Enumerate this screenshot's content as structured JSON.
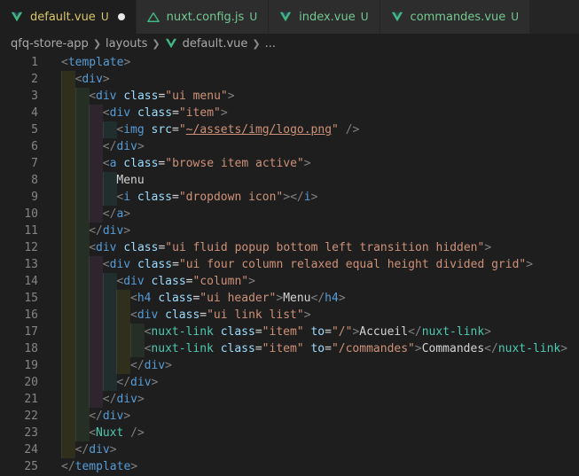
{
  "tabs": [
    {
      "label": "default.vue",
      "status": "U",
      "icon": "vue-icon",
      "active": true,
      "dirty": true,
      "untracked": true
    },
    {
      "label": "nuxt.config.js",
      "status": "U",
      "icon": "nuxt-icon",
      "active": false,
      "dirty": false,
      "untracked": true
    },
    {
      "label": "index.vue",
      "status": "U",
      "icon": "vue-icon",
      "active": false,
      "dirty": false,
      "untracked": true
    },
    {
      "label": "commandes.vue",
      "status": "U",
      "icon": "vue-icon",
      "active": false,
      "dirty": false,
      "untracked": true
    }
  ],
  "breadcrumb": {
    "root": "qfq-store-app",
    "folder": "layouts",
    "file": "default.vue",
    "more": "..."
  },
  "colors": {
    "tag": "#569cd6",
    "component": "#4ec9b0",
    "attribute": "#9cdcfe",
    "string": "#ce9178",
    "punctuation": "#808080",
    "text": "#d4d4d4",
    "vue_green": "#41b883",
    "modified_yellow": "#d9c56a",
    "untracked_green": "#73c991"
  },
  "editor": {
    "lines": [
      {
        "n": "1",
        "indent": 0,
        "tokens": [
          [
            "p",
            "<"
          ],
          [
            "tag",
            "template"
          ],
          [
            "p",
            ">"
          ]
        ]
      },
      {
        "n": "2",
        "indent": 1,
        "tokens": [
          [
            "p",
            "<"
          ],
          [
            "tag",
            "div"
          ],
          [
            "p",
            ">"
          ]
        ]
      },
      {
        "n": "3",
        "indent": 2,
        "tokens": [
          [
            "p",
            "<"
          ],
          [
            "tag",
            "div"
          ],
          [
            "text",
            " "
          ],
          [
            "attr",
            "class"
          ],
          [
            "eq",
            "="
          ],
          [
            "str",
            "\"ui menu\""
          ],
          [
            "p",
            ">"
          ]
        ]
      },
      {
        "n": "4",
        "indent": 3,
        "tokens": [
          [
            "p",
            "<"
          ],
          [
            "tag",
            "div"
          ],
          [
            "text",
            " "
          ],
          [
            "attr",
            "class"
          ],
          [
            "eq",
            "="
          ],
          [
            "str",
            "\"item\""
          ],
          [
            "p",
            ">"
          ]
        ]
      },
      {
        "n": "5",
        "indent": 4,
        "tokens": [
          [
            "p",
            "<"
          ],
          [
            "tag",
            "img"
          ],
          [
            "text",
            " "
          ],
          [
            "attr",
            "src"
          ],
          [
            "eq",
            "="
          ],
          [
            "str",
            "\""
          ],
          [
            "strlink",
            "~/assets/img/logo.png"
          ],
          [
            "str",
            "\""
          ],
          [
            "text",
            " "
          ],
          [
            "p",
            "/>"
          ]
        ]
      },
      {
        "n": "6",
        "indent": 3,
        "tokens": [
          [
            "p",
            "</"
          ],
          [
            "tag",
            "div"
          ],
          [
            "p",
            ">"
          ]
        ]
      },
      {
        "n": "7",
        "indent": 3,
        "tokens": [
          [
            "p",
            "<"
          ],
          [
            "tag",
            "a"
          ],
          [
            "text",
            " "
          ],
          [
            "attr",
            "class"
          ],
          [
            "eq",
            "="
          ],
          [
            "str",
            "\"browse item active\""
          ],
          [
            "p",
            ">"
          ]
        ]
      },
      {
        "n": "8",
        "indent": 4,
        "tokens": [
          [
            "text",
            "Menu"
          ]
        ]
      },
      {
        "n": "9",
        "indent": 4,
        "tokens": [
          [
            "p",
            "<"
          ],
          [
            "tag",
            "i"
          ],
          [
            "text",
            " "
          ],
          [
            "attr",
            "class"
          ],
          [
            "eq",
            "="
          ],
          [
            "str",
            "\"dropdown icon\""
          ],
          [
            "p",
            "></"
          ],
          [
            "tag",
            "i"
          ],
          [
            "p",
            ">"
          ]
        ]
      },
      {
        "n": "10",
        "indent": 3,
        "tokens": [
          [
            "p",
            "</"
          ],
          [
            "tag",
            "a"
          ],
          [
            "p",
            ">"
          ]
        ]
      },
      {
        "n": "11",
        "indent": 2,
        "tokens": [
          [
            "p",
            "</"
          ],
          [
            "tag",
            "div"
          ],
          [
            "p",
            ">"
          ]
        ]
      },
      {
        "n": "12",
        "indent": 2,
        "tokens": [
          [
            "p",
            "<"
          ],
          [
            "tag",
            "div"
          ],
          [
            "text",
            " "
          ],
          [
            "attr",
            "class"
          ],
          [
            "eq",
            "="
          ],
          [
            "str",
            "\"ui fluid popup bottom left transition hidden\""
          ],
          [
            "p",
            ">"
          ]
        ]
      },
      {
        "n": "13",
        "indent": 3,
        "tokens": [
          [
            "p",
            "<"
          ],
          [
            "tag",
            "div"
          ],
          [
            "text",
            " "
          ],
          [
            "attr",
            "class"
          ],
          [
            "eq",
            "="
          ],
          [
            "str",
            "\"ui four column relaxed equal height divided grid\""
          ],
          [
            "p",
            ">"
          ]
        ]
      },
      {
        "n": "14",
        "indent": 4,
        "tokens": [
          [
            "p",
            "<"
          ],
          [
            "tag",
            "div"
          ],
          [
            "text",
            " "
          ],
          [
            "attr",
            "class"
          ],
          [
            "eq",
            "="
          ],
          [
            "str",
            "\"column\""
          ],
          [
            "p",
            ">"
          ]
        ]
      },
      {
        "n": "15",
        "indent": 5,
        "tokens": [
          [
            "p",
            "<"
          ],
          [
            "tag",
            "h4"
          ],
          [
            "text",
            " "
          ],
          [
            "attr",
            "class"
          ],
          [
            "eq",
            "="
          ],
          [
            "str",
            "\"ui header\""
          ],
          [
            "p",
            ">"
          ],
          [
            "text",
            "Menu"
          ],
          [
            "p",
            "</"
          ],
          [
            "tag",
            "h4"
          ],
          [
            "p",
            ">"
          ]
        ]
      },
      {
        "n": "16",
        "indent": 5,
        "tokens": [
          [
            "p",
            "<"
          ],
          [
            "tag",
            "div"
          ],
          [
            "text",
            " "
          ],
          [
            "attr",
            "class"
          ],
          [
            "eq",
            "="
          ],
          [
            "str",
            "\"ui link list\""
          ],
          [
            "p",
            ">"
          ]
        ]
      },
      {
        "n": "17",
        "indent": 6,
        "tokens": [
          [
            "p",
            "<"
          ],
          [
            "comp",
            "nuxt-link"
          ],
          [
            "text",
            " "
          ],
          [
            "attr",
            "class"
          ],
          [
            "eq",
            "="
          ],
          [
            "str",
            "\"item\""
          ],
          [
            "text",
            " "
          ],
          [
            "attr",
            "to"
          ],
          [
            "eq",
            "="
          ],
          [
            "str",
            "\"/\""
          ],
          [
            "p",
            ">"
          ],
          [
            "text",
            "Accueil"
          ],
          [
            "p",
            "</"
          ],
          [
            "comp",
            "nuxt-link"
          ],
          [
            "p",
            ">"
          ]
        ]
      },
      {
        "n": "18",
        "indent": 6,
        "tokens": [
          [
            "p",
            "<"
          ],
          [
            "comp",
            "nuxt-link"
          ],
          [
            "text",
            " "
          ],
          [
            "attr",
            "class"
          ],
          [
            "eq",
            "="
          ],
          [
            "str",
            "\"item\""
          ],
          [
            "text",
            " "
          ],
          [
            "attr",
            "to"
          ],
          [
            "eq",
            "="
          ],
          [
            "str",
            "\"/commandes\""
          ],
          [
            "p",
            ">"
          ],
          [
            "text",
            "Commandes"
          ],
          [
            "p",
            "</"
          ],
          [
            "comp",
            "nuxt-link"
          ],
          [
            "p",
            ">"
          ]
        ]
      },
      {
        "n": "19",
        "indent": 5,
        "tokens": [
          [
            "p",
            "</"
          ],
          [
            "tag",
            "div"
          ],
          [
            "p",
            ">"
          ]
        ]
      },
      {
        "n": "20",
        "indent": 4,
        "tokens": [
          [
            "p",
            "</"
          ],
          [
            "tag",
            "div"
          ],
          [
            "p",
            ">"
          ]
        ]
      },
      {
        "n": "21",
        "indent": 3,
        "tokens": [
          [
            "p",
            "</"
          ],
          [
            "tag",
            "div"
          ],
          [
            "p",
            ">"
          ]
        ]
      },
      {
        "n": "22",
        "indent": 2,
        "tokens": [
          [
            "p",
            "</"
          ],
          [
            "tag",
            "div"
          ],
          [
            "p",
            ">"
          ]
        ]
      },
      {
        "n": "23",
        "indent": 2,
        "tokens": [
          [
            "p",
            "<"
          ],
          [
            "comp",
            "Nuxt"
          ],
          [
            "text",
            " "
          ],
          [
            "p",
            "/>"
          ]
        ]
      },
      {
        "n": "24",
        "indent": 1,
        "tokens": [
          [
            "p",
            "</"
          ],
          [
            "tag",
            "div"
          ],
          [
            "p",
            ">"
          ]
        ]
      },
      {
        "n": "25",
        "indent": 0,
        "tokens": [
          [
            "p",
            "</"
          ],
          [
            "tag",
            "template"
          ],
          [
            "p",
            ">"
          ]
        ]
      }
    ]
  }
}
